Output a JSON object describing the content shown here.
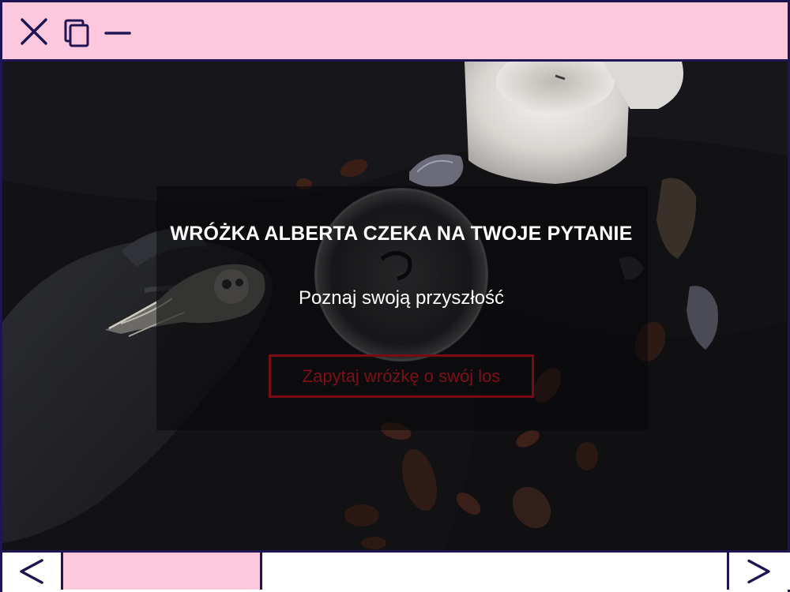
{
  "window": {
    "controls": {
      "close_icon": "close-icon",
      "restore_icon": "restore-icon",
      "minimize_icon": "minimize-icon"
    }
  },
  "hero": {
    "title": "WRÓŻKA ALBERTA CZEKA NA TWOJE PYTANIE",
    "subtitle": "Poznaj swoją przyszłość",
    "cta_label": "Zapytaj wróżkę o swój los"
  },
  "scrollbar": {
    "left_icon": "chevron-left-icon",
    "right_icon": "chevron-right-icon",
    "position_fraction": 0.0,
    "thumb_fraction": 0.3
  },
  "colors": {
    "accent_pink": "#fdc8dd",
    "frame_navy": "#1f1552",
    "cta_red": "#7a0b13",
    "background_dark": "#0e0e11"
  }
}
